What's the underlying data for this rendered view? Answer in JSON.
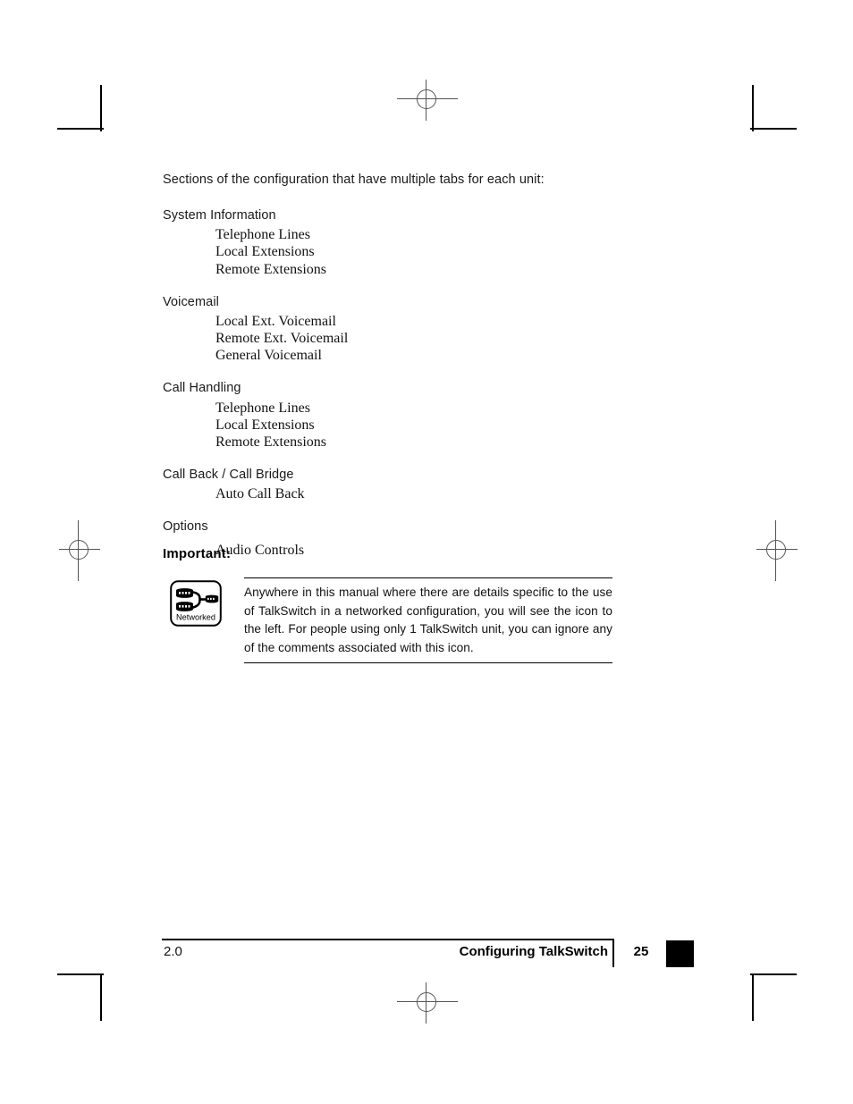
{
  "document": {
    "intro": "Sections of the configuration that have multiple tabs for each unit:",
    "groups": [
      {
        "title": "System Information",
        "items": [
          "Telephone Lines",
          "Local Extensions",
          "Remote Extensions"
        ]
      },
      {
        "title": "Voicemail",
        "items": [
          "Local Ext. Voicemail",
          "Remote Ext. Voicemail",
          "General Voicemail"
        ]
      },
      {
        "title": "Call Handling",
        "items": [
          "Telephone Lines",
          "Local Extensions",
          "Remote Extensions"
        ]
      },
      {
        "title": "Call Back / Call Bridge",
        "items": [
          "Auto Call Back"
        ]
      },
      {
        "title": "Options",
        "items": [
          "Audio Controls"
        ]
      }
    ]
  },
  "important": {
    "heading": "Important:",
    "icon_label": "Networked",
    "note": "Anywhere in this manual where there are details specific to the use of TalkSwitch in a networked configuration, you will see the icon to the left. For people using only 1 TalkSwitch unit, you can ignore any of the comments associated with this icon."
  },
  "footer": {
    "version": "2.0",
    "section": "Configuring TalkSwitch",
    "page_number": "25"
  }
}
